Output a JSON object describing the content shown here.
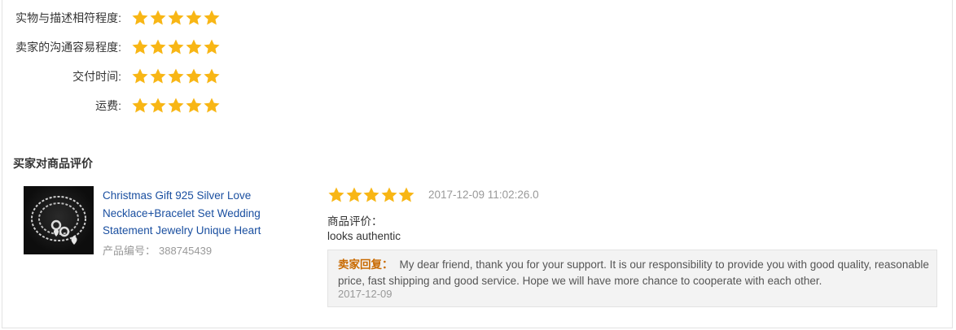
{
  "seller_ratings": [
    {
      "label": "实物与描述相符程度:",
      "stars": 5
    },
    {
      "label": "卖家的沟通容易程度:",
      "stars": 5
    },
    {
      "label": "交付时间:",
      "stars": 5
    },
    {
      "label": "运费:",
      "stars": 5
    }
  ],
  "section_title": "买家对商品评价",
  "product": {
    "title": "Christmas Gift 925 Silver Love Necklace+Bracelet Set Wedding Statement Jewelry Unique Heart",
    "id_label": "产品编号：",
    "id_value": "388745439"
  },
  "review": {
    "stars": 5,
    "date": "2017-12-09 11:02:26.0",
    "label": "商品评价：",
    "text": "looks authentic"
  },
  "reply": {
    "label": "卖家回复：",
    "text": "My dear friend, thank you for your support. It is our responsibility to provide you with good quality, reasonable price, fast shipping and good service. Hope we will have more chance to cooperate with each other.",
    "date": "2017-12-09"
  },
  "colors": {
    "star": "#f8b615",
    "link": "#1a4fa0",
    "reply_label": "#c96a00"
  }
}
